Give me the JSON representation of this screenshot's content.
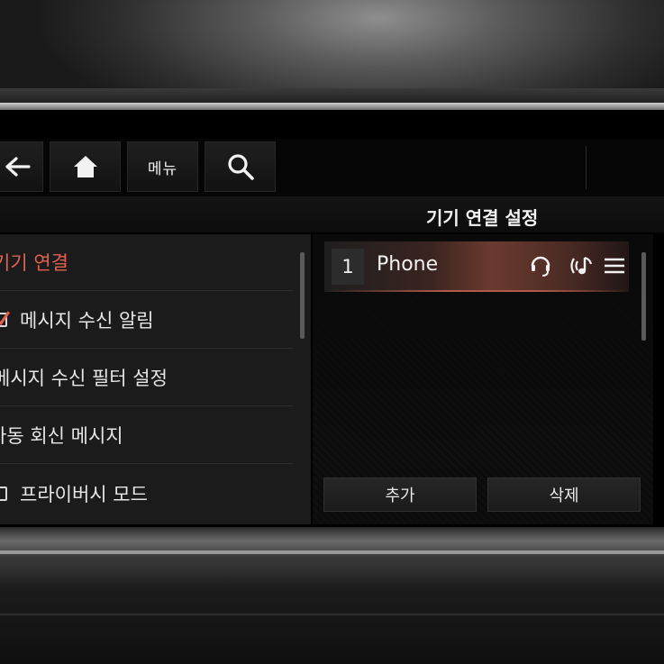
{
  "toolbar": {
    "menu_label": "메뉴"
  },
  "screen_title": "기기 연결 설정",
  "left_menu": {
    "items": [
      {
        "label": "기기 연결",
        "active": true,
        "checkbox": null
      },
      {
        "label": "메시지 수신 알림",
        "active": false,
        "checkbox": true
      },
      {
        "label": "메시지 수신 필터 설정",
        "active": false,
        "checkbox": null
      },
      {
        "label": "자동 회신 메시지",
        "active": false,
        "checkbox": null
      },
      {
        "label": "프라이버시 모드",
        "active": false,
        "checkbox": false
      }
    ]
  },
  "devices": [
    {
      "index": "1",
      "name": "Phone",
      "icons": [
        "headset-icon",
        "bluetooth-audio-icon",
        "list-menu-icon"
      ]
    }
  ],
  "actions": {
    "add_label": "추가",
    "delete_label": "삭제"
  },
  "colors": {
    "accent": "#e3604f",
    "panel": "#1b1b1b",
    "selected_row": "#6a3a30"
  }
}
